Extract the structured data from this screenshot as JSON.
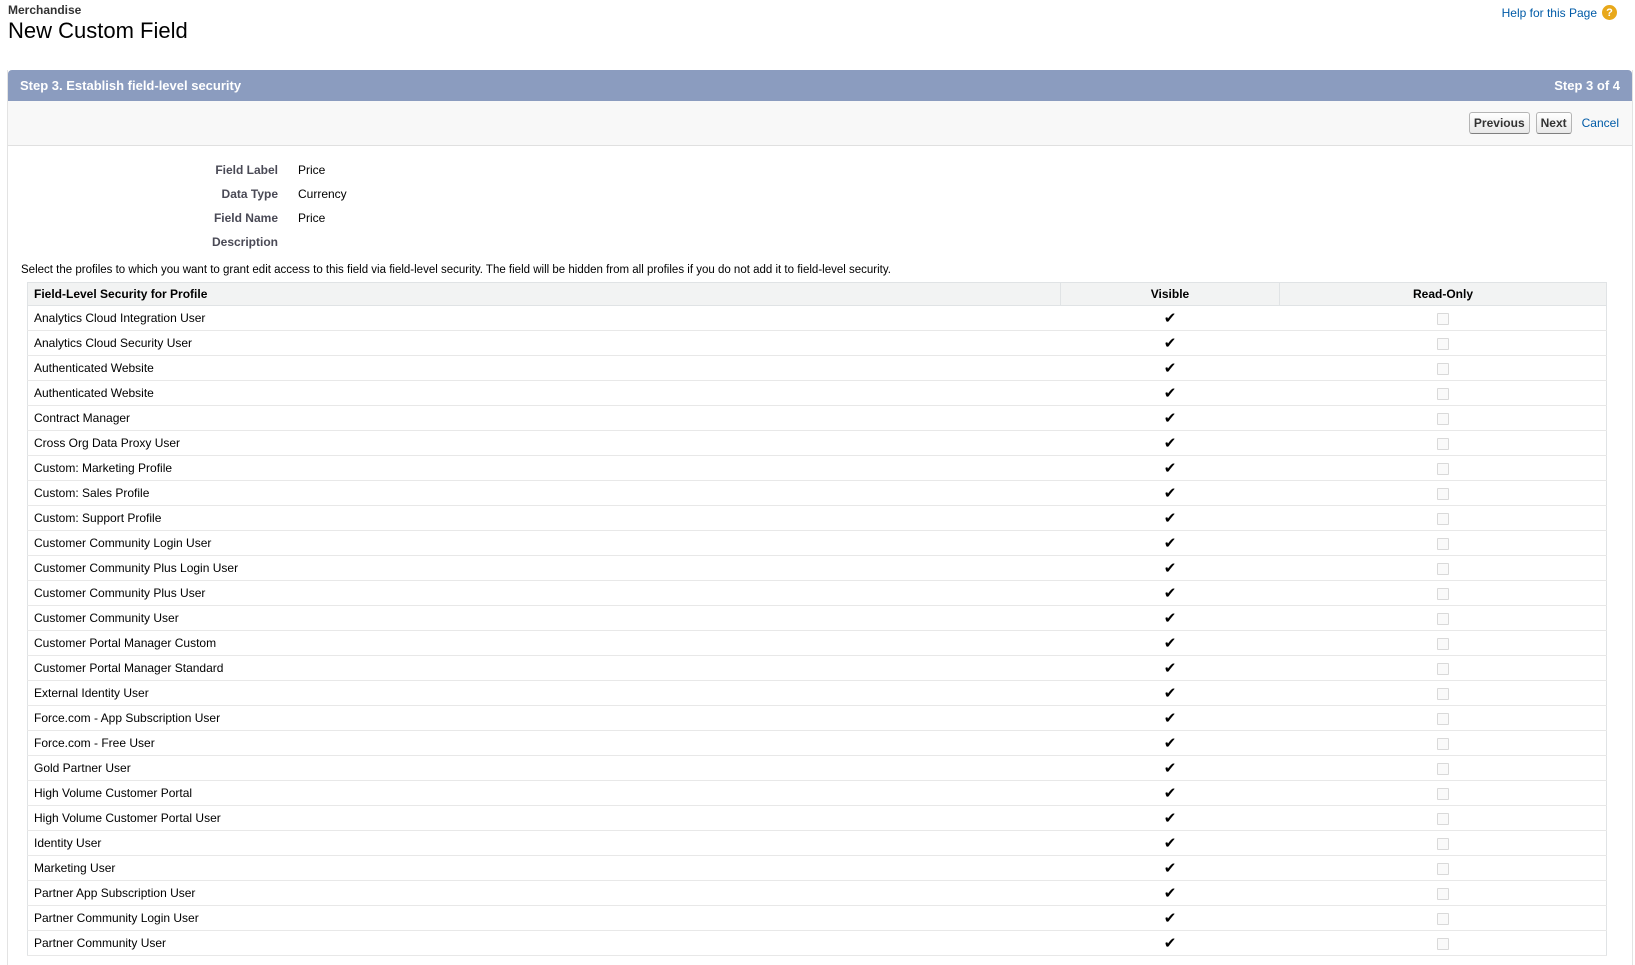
{
  "header": {
    "object_name": "Merchandise",
    "title": "New Custom Field",
    "help_label": "Help for this Page",
    "help_icon_glyph": "?"
  },
  "step": {
    "title": "Step 3. Establish field-level security",
    "counter": "Step 3 of 4"
  },
  "buttons": {
    "previous": "Previous",
    "next": "Next",
    "cancel": "Cancel"
  },
  "details": [
    {
      "label": "Field Label",
      "value": "Price"
    },
    {
      "label": "Data Type",
      "value": "Currency"
    },
    {
      "label": "Field Name",
      "value": "Price"
    },
    {
      "label": "Description",
      "value": ""
    }
  ],
  "instructions": "Select the profiles to which you want to grant edit access to this field via field-level security. The field will be hidden from all profiles if you do not add it to field-level security.",
  "table": {
    "columns": [
      "Field-Level Security for Profile",
      "Visible",
      "Read-Only"
    ],
    "check_glyph": "✔",
    "rows": [
      {
        "profile": "Analytics Cloud Integration User",
        "visible": true,
        "read_only": false
      },
      {
        "profile": "Analytics Cloud Security User",
        "visible": true,
        "read_only": false
      },
      {
        "profile": "Authenticated Website",
        "visible": true,
        "read_only": false
      },
      {
        "profile": "Authenticated Website",
        "visible": true,
        "read_only": false
      },
      {
        "profile": "Contract Manager",
        "visible": true,
        "read_only": false
      },
      {
        "profile": "Cross Org Data Proxy User",
        "visible": true,
        "read_only": false
      },
      {
        "profile": "Custom: Marketing Profile",
        "visible": true,
        "read_only": false
      },
      {
        "profile": "Custom: Sales Profile",
        "visible": true,
        "read_only": false
      },
      {
        "profile": "Custom: Support Profile",
        "visible": true,
        "read_only": false
      },
      {
        "profile": "Customer Community Login User",
        "visible": true,
        "read_only": false
      },
      {
        "profile": "Customer Community Plus Login User",
        "visible": true,
        "read_only": false
      },
      {
        "profile": "Customer Community Plus User",
        "visible": true,
        "read_only": false
      },
      {
        "profile": "Customer Community User",
        "visible": true,
        "read_only": false
      },
      {
        "profile": "Customer Portal Manager Custom",
        "visible": true,
        "read_only": false
      },
      {
        "profile": "Customer Portal Manager Standard",
        "visible": true,
        "read_only": false
      },
      {
        "profile": "External Identity User",
        "visible": true,
        "read_only": false
      },
      {
        "profile": "Force.com - App Subscription User",
        "visible": true,
        "read_only": false
      },
      {
        "profile": "Force.com - Free User",
        "visible": true,
        "read_only": false
      },
      {
        "profile": "Gold Partner User",
        "visible": true,
        "read_only": false
      },
      {
        "profile": "High Volume Customer Portal",
        "visible": true,
        "read_only": false
      },
      {
        "profile": "High Volume Customer Portal User",
        "visible": true,
        "read_only": false
      },
      {
        "profile": "Identity User",
        "visible": true,
        "read_only": false
      },
      {
        "profile": "Marketing User",
        "visible": true,
        "read_only": false
      },
      {
        "profile": "Partner App Subscription User",
        "visible": true,
        "read_only": false
      },
      {
        "profile": "Partner Community Login User",
        "visible": true,
        "read_only": false
      },
      {
        "profile": "Partner Community User",
        "visible": true,
        "read_only": false
      }
    ]
  }
}
